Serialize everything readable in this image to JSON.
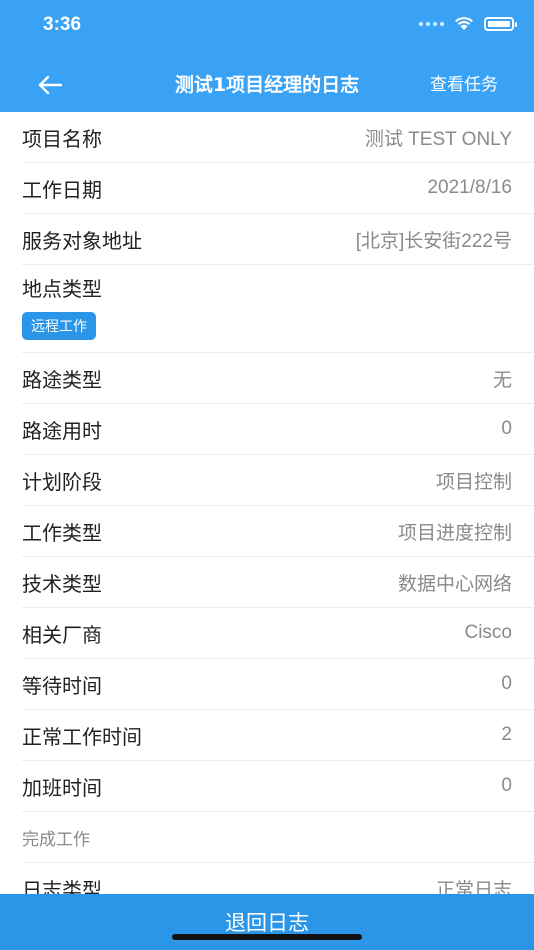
{
  "status_bar": {
    "time": "3:36"
  },
  "nav": {
    "title": "测试1项目经理的日志",
    "action": "查看任务"
  },
  "fields": [
    {
      "label": "项目名称",
      "value": "测试 TEST ONLY"
    },
    {
      "label": "工作日期",
      "value": "2021/8/16"
    },
    {
      "label": "服务对象地址",
      "value": "[北京]长安街222号"
    },
    {
      "label": "地点类型",
      "tag": "远程工作"
    },
    {
      "label": "路途类型",
      "value": "无"
    },
    {
      "label": "路途用时",
      "value": "0"
    },
    {
      "label": "计划阶段",
      "value": "项目控制"
    },
    {
      "label": "工作类型",
      "value": "项目进度控制"
    },
    {
      "label": "技术类型",
      "value": "数据中心网络"
    },
    {
      "label": "相关厂商",
      "value": "Cisco"
    },
    {
      "label": "等待时间",
      "value": "0"
    },
    {
      "label": "正常工作时间",
      "value": "2"
    },
    {
      "label": "加班时间",
      "value": "0"
    },
    {
      "label": "完成工作"
    },
    {
      "label": "日志类型",
      "value": "正常日志"
    }
  ],
  "footer": {
    "button": "退回日志"
  },
  "colors": {
    "header": "#3aa2f4",
    "tag": "#2b95e8",
    "footer": "#2b95e8"
  }
}
